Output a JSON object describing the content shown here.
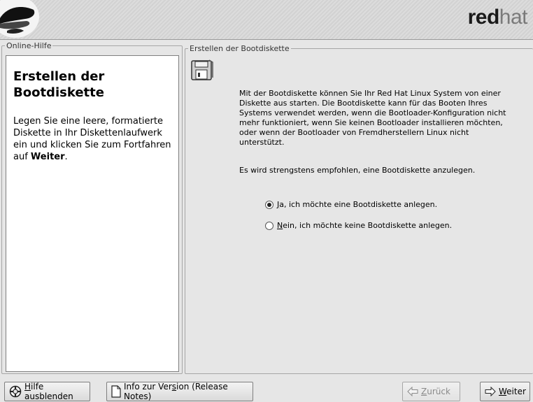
{
  "banner": {
    "brand_bold": "red",
    "brand_light": "hat"
  },
  "help": {
    "frame_label": "Online-Hilfe",
    "title": "Erstellen der Bootdiskette",
    "text_before": "Legen Sie eine leere, formatierte Diskette in Ihr Diskettenlaufwerk ein und klicken Sie zum Fortfahren auf ",
    "text_bold": "Weiter",
    "text_after": "."
  },
  "main": {
    "frame_label": "Erstellen der Bootdiskette",
    "description": "Mit der Bootdiskette können Sie Ihr Red Hat Linux System von einer Diskette aus starten. Die Bootdiskette kann für das Booten Ihres Systems verwendet werden, wenn die Bootloader-Konfiguration nicht mehr funktioniert, wenn Sie keinen Bootloader installieren möchten, oder wenn der Bootloader von Fremdherstellern Linux nicht unterstützt.",
    "recommendation": "Es wird strengstens empfohlen, eine Bootdiskette anzulegen.",
    "option_yes": {
      "mnemonic": "J",
      "rest": "a, ich möchte eine Bootdiskette anlegen.",
      "selected": true
    },
    "option_no": {
      "mnemonic": "N",
      "rest": "ein, ich möchte keine Bootdiskette anlegen.",
      "selected": false
    }
  },
  "buttons": {
    "hide_help": {
      "mnemonic": "H",
      "rest": "ilfe ausblenden"
    },
    "release_notes": {
      "before": "Info zur Ver",
      "mnemonic": "s",
      "after": "ion (Release Notes)"
    },
    "back": {
      "mnemonic": "Z",
      "rest": "urück"
    },
    "next": {
      "mnemonic": "W",
      "rest": "eiter"
    }
  },
  "icons": {
    "logo": "redhat-shadowman-icon",
    "floppy": "floppy-disk-icon",
    "help": "lifebuoy-icon",
    "notes": "document-icon",
    "back": "arrow-left-icon",
    "next": "arrow-right-icon"
  }
}
